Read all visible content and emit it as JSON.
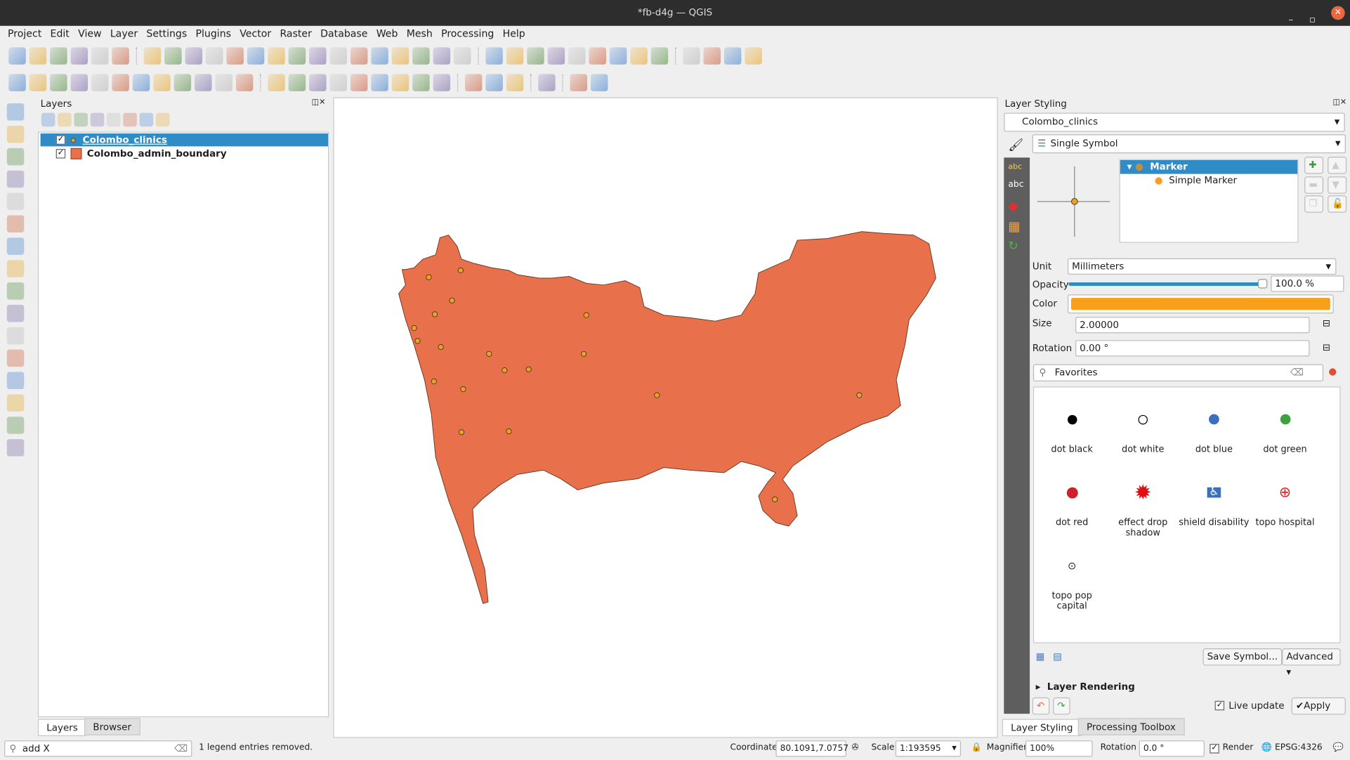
{
  "window": {
    "title": "*fb-d4g — QGIS"
  },
  "menu": [
    "Project",
    "Edit",
    "View",
    "Layer",
    "Settings",
    "Plugins",
    "Vector",
    "Raster",
    "Database",
    "Web",
    "Mesh",
    "Processing",
    "Help"
  ],
  "layers_panel": {
    "title": "Layers",
    "layers": [
      {
        "name": "Colombo_clinics",
        "checked": true,
        "selected": true,
        "icon": "point-layer-icon"
      },
      {
        "name": "Colombo_admin_boundary",
        "checked": true,
        "selected": false,
        "icon": "polygon-layer-icon",
        "color": "#e8704a"
      }
    ],
    "tabs": [
      "Layers",
      "Browser"
    ]
  },
  "map": {
    "polygon_color": "#e8704a",
    "point_color": "#f0a020",
    "points": [
      [
        79.86,
        6.98
      ]
    ]
  },
  "styling": {
    "title": "Layer Styling",
    "layer": "Colombo_clinics",
    "renderer": "Single Symbol",
    "tree": {
      "root": "Marker",
      "child": "Simple Marker"
    },
    "unit_label": "Unit",
    "unit": "Millimeters",
    "opacity_label": "Opacity",
    "opacity": "100.0 %",
    "opacity_value": 100,
    "color_label": "Color",
    "color": "#f9a01b",
    "size_label": "Size",
    "size": "2.00000",
    "rotation_label": "Rotation",
    "rotation": "0.00 °",
    "search": "Favorites",
    "symbols": [
      {
        "name": "dot  black"
      },
      {
        "name": "dot  white"
      },
      {
        "name": "dot blue"
      },
      {
        "name": "dot green"
      },
      {
        "name": "dot red"
      },
      {
        "name": "effect drop shadow"
      },
      {
        "name": "shield disability"
      },
      {
        "name": "topo hospital"
      },
      {
        "name": "topo pop capital"
      }
    ],
    "save_symbol": "Save Symbol...",
    "advanced": "Advanced",
    "layer_rendering": "Layer Rendering",
    "live_update": "Live update",
    "live_update_checked": true,
    "apply": "Apply",
    "tabs": [
      "Layer Styling",
      "Processing Toolbox"
    ]
  },
  "status": {
    "search": "add X",
    "message": "1 legend entries removed.",
    "coordinate_label": "Coordinate",
    "coordinate": "80.1091,7.0757",
    "scale_label": "Scale",
    "scale": "1:193595",
    "magnifier_label": "Magnifier",
    "magnifier": "100%",
    "rotation_label": "Rotation",
    "rotation": "0.0 °",
    "render": "Render",
    "crs": "EPSG:4326"
  }
}
